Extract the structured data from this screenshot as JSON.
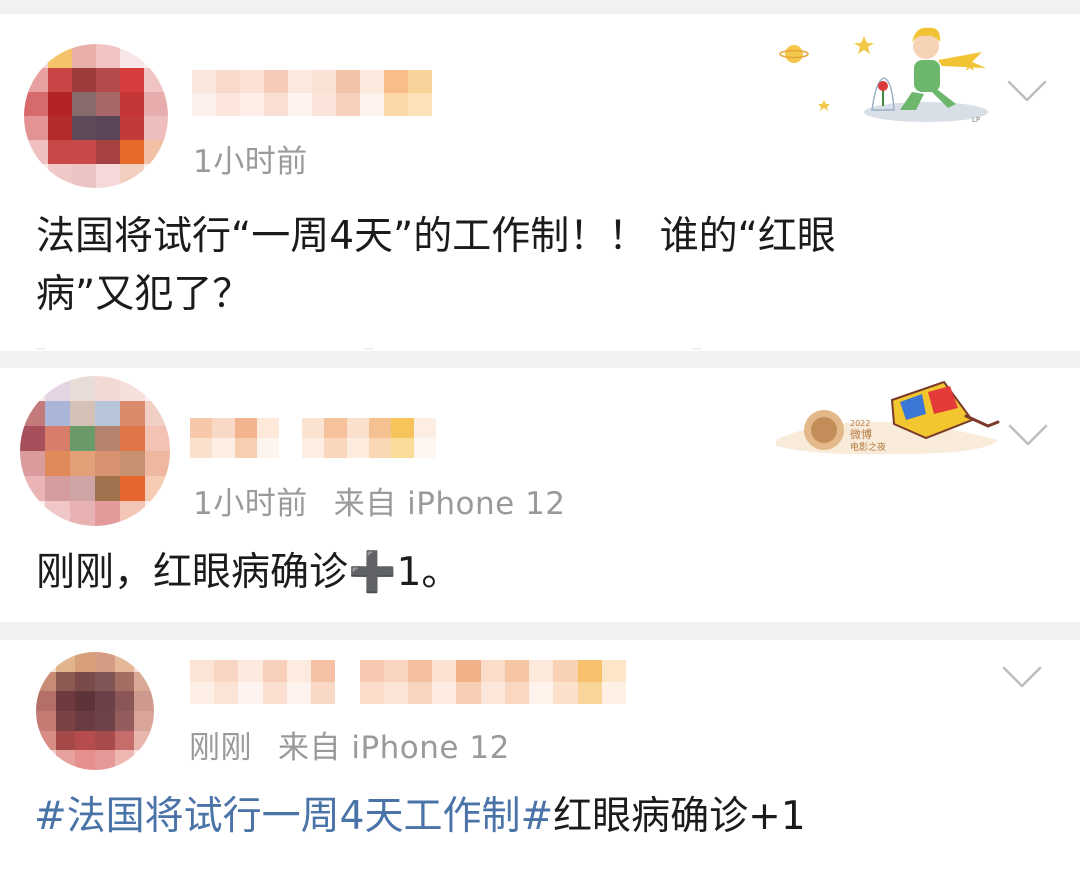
{
  "posts": [
    {
      "time": "1小时前",
      "source": "",
      "content_line1": "法国将试行“一周4天”的工作制！！ 谁的“红眼",
      "content_line2": "病”又犯了？"
    },
    {
      "time": "1小时前",
      "source": "来自 iPhone 12",
      "content_before_icon": "刚刚，红眼病确诊",
      "content_icon": "➕",
      "content_after_icon": "1。"
    },
    {
      "time": "刚刚",
      "source": "来自 iPhone 12",
      "hashtag": "#法国将试行一周4天工作制#",
      "content_after_hashtag": "红眼病确诊+1"
    }
  ],
  "icons": {
    "more": "chevron-down-icon",
    "sticker1": "little-prince-sticker",
    "sticker2": "3d-glasses-sticker"
  },
  "colors": {
    "hashtag": "#4a73a8",
    "meta": "#9a9a9a",
    "text": "#1b1b1b"
  }
}
